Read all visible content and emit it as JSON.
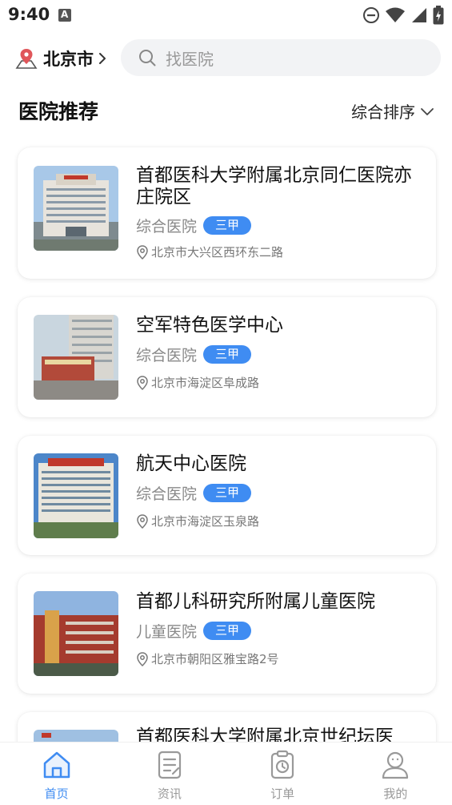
{
  "status_bar": {
    "time": "9:40"
  },
  "top_bar": {
    "city": "北京市",
    "search_placeholder": "找医院"
  },
  "section": {
    "title": "医院推荐",
    "sort_label": "综合排序"
  },
  "hospitals": [
    {
      "name": "首都医科大学附属北京同仁医院亦庄院区",
      "type": "综合医院",
      "grade": "三甲",
      "address": "北京市大兴区西环东二路"
    },
    {
      "name": "空军特色医学中心",
      "type": "综合医院",
      "grade": "三甲",
      "address": "北京市海淀区阜成路"
    },
    {
      "name": "航天中心医院",
      "type": "综合医院",
      "grade": "三甲",
      "address": "北京市海淀区玉泉路"
    },
    {
      "name": "首都儿科研究所附属儿童医院",
      "type": "儿童医院",
      "grade": "三甲",
      "address": "北京市朝阳区雅宝路2号"
    },
    {
      "name": "首都医科大学附属北京世纪坛医"
    }
  ],
  "bottom_nav": {
    "items": [
      {
        "label": "首页",
        "icon": "home-icon",
        "active": true
      },
      {
        "label": "资讯",
        "icon": "news-icon",
        "active": false
      },
      {
        "label": "订单",
        "icon": "order-icon",
        "active": false
      },
      {
        "label": "我的",
        "icon": "profile-icon",
        "active": false
      }
    ]
  },
  "colors": {
    "accent": "#3f8cf2",
    "location_pin": "#e0565a",
    "search_bg": "#f2f3f5"
  }
}
